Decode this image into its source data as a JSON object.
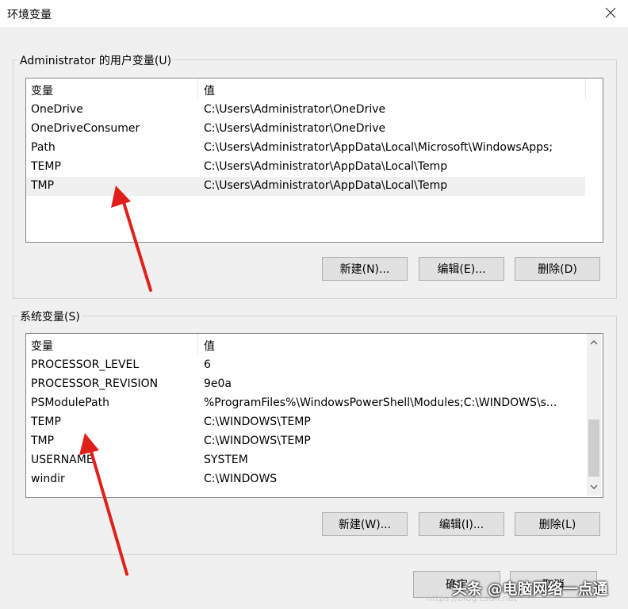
{
  "window": {
    "title": "环境变量"
  },
  "user_vars": {
    "label": "Administrator 的用户变量(U)",
    "col_var": "变量",
    "col_val": "值",
    "rows": [
      {
        "name": "OneDrive",
        "value": "C:\\Users\\Administrator\\OneDrive"
      },
      {
        "name": "OneDriveConsumer",
        "value": "C:\\Users\\Administrator\\OneDrive"
      },
      {
        "name": "Path",
        "value": "C:\\Users\\Administrator\\AppData\\Local\\Microsoft\\WindowsApps;"
      },
      {
        "name": "TEMP",
        "value": "C:\\Users\\Administrator\\AppData\\Local\\Temp"
      },
      {
        "name": "TMP",
        "value": "C:\\Users\\Administrator\\AppData\\Local\\Temp"
      }
    ],
    "buttons": {
      "new": "新建(N)...",
      "edit": "编辑(E)...",
      "delete": "删除(D)"
    }
  },
  "system_vars": {
    "label": "系统变量(S)",
    "col_var": "变量",
    "col_val": "值",
    "rows": [
      {
        "name": "PROCESSOR_LEVEL",
        "value": "6"
      },
      {
        "name": "PROCESSOR_REVISION",
        "value": "9e0a"
      },
      {
        "name": "PSModulePath",
        "value": "%ProgramFiles%\\WindowsPowerShell\\Modules;C:\\WINDOWS\\s..."
      },
      {
        "name": "TEMP",
        "value": "C:\\WINDOWS\\TEMP"
      },
      {
        "name": "TMP",
        "value": "C:\\WINDOWS\\TEMP"
      },
      {
        "name": "USERNAME",
        "value": "SYSTEM"
      },
      {
        "name": "windir",
        "value": "C:\\WINDOWS"
      }
    ],
    "buttons": {
      "new": "新建(W)...",
      "edit": "编辑(I)...",
      "delete": "删除(L)"
    }
  },
  "footer": {
    "ok": "确定",
    "cancel": "取消"
  },
  "watermark": {
    "text": "头条 @电脑网络一点通"
  },
  "colors": {
    "arrow": "#e0201b",
    "selected_row": "#f0f0f0",
    "list_border": "#828790"
  }
}
